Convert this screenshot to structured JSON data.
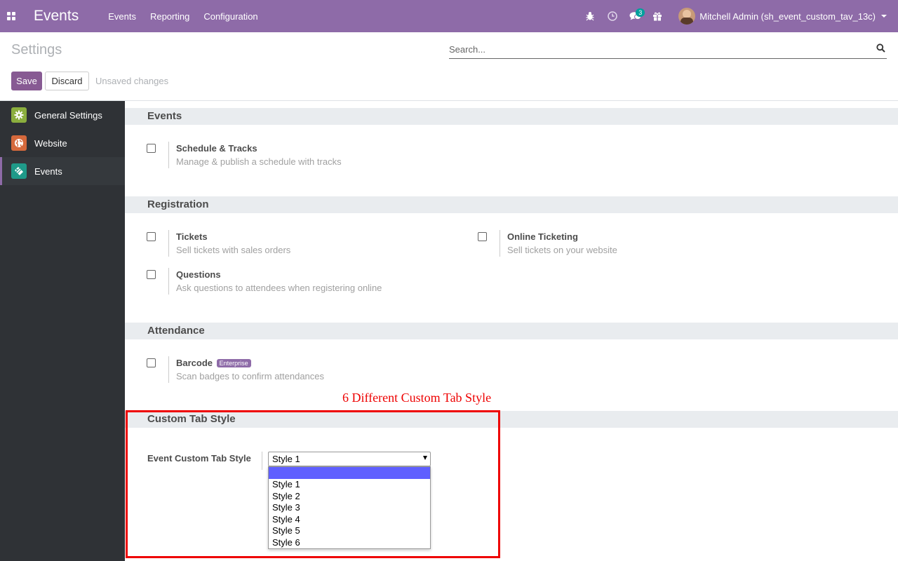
{
  "navbar": {
    "brand": "Events",
    "menu": [
      "Events",
      "Reporting",
      "Configuration"
    ],
    "messages_count": "3",
    "user": "Mitchell Admin (sh_event_custom_tav_13c)",
    "color": "#8e6ba8"
  },
  "control": {
    "title": "Settings",
    "search_placeholder": "Search...",
    "save_label": "Save",
    "discard_label": "Discard",
    "status": "Unsaved changes"
  },
  "sidebar": {
    "items": [
      {
        "label": "General Settings",
        "icon": "gear-icon",
        "color": "#8bae3e"
      },
      {
        "label": "Website",
        "icon": "globe-icon",
        "color": "#d5693c"
      },
      {
        "label": "Events",
        "icon": "tag-icon",
        "color": "#1f9a89",
        "active": true
      }
    ]
  },
  "sections": {
    "events": {
      "title": "Events",
      "schedule": {
        "label": "Schedule & Tracks",
        "desc": "Manage & publish a schedule with tracks"
      }
    },
    "registration": {
      "title": "Registration",
      "tickets": {
        "label": "Tickets",
        "desc": "Sell tickets with sales orders"
      },
      "online": {
        "label": "Online Ticketing",
        "desc": "Sell tickets on your website"
      },
      "questions": {
        "label": "Questions",
        "desc": "Ask questions to attendees when registering online"
      }
    },
    "attendance": {
      "title": "Attendance",
      "barcode": {
        "label": "Barcode",
        "badge": "Enterprise",
        "desc": "Scan badges to confirm attendances"
      }
    },
    "custom_tab": {
      "title": "Custom Tab Style",
      "field_label": "Event Custom Tab Style",
      "selected": "Style 1",
      "options": [
        "",
        "Style 1",
        "Style 2",
        "Style 3",
        "Style 4",
        "Style 5",
        "Style 6"
      ]
    }
  },
  "annotation": {
    "text": "6 Different Custom Tab Style",
    "color": "#e00000"
  }
}
